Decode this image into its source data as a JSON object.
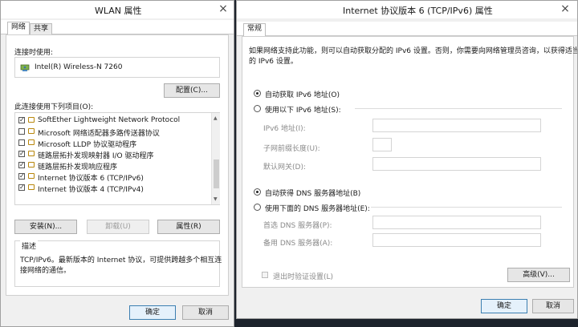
{
  "wlan": {
    "title": "WLAN 属性",
    "tabs": [
      "网络",
      "共享"
    ],
    "connect_label": "连接时使用:",
    "adapter_name": "Intel(R) Wireless-N 7260",
    "configure_label": "配置(C)...",
    "items_label": "此连接使用下列项目(O):",
    "items": [
      {
        "label": "SoftEther Lightweight Network Protocol",
        "checked": true
      },
      {
        "label": "Microsoft 网络适配器多路传送器协议",
        "checked": false
      },
      {
        "label": "Microsoft LLDP 协议驱动程序",
        "checked": false
      },
      {
        "label": "链路层拓扑发现映射器 I/O 驱动程序",
        "checked": true
      },
      {
        "label": "链路层拓扑发现响应程序",
        "checked": true
      },
      {
        "label": "Internet 协议版本 6 (TCP/IPv6)",
        "checked": true
      },
      {
        "label": "Internet 协议版本 4 (TCP/IPv4)",
        "checked": true
      }
    ],
    "install_label": "安装(N)...",
    "uninstall_label": "卸载(U)",
    "properties_label": "属性(R)",
    "desc_title": "描述",
    "desc_line1": "TCP/IPv6。最新版本的 Internet 协议，可提供跨越多个相互连",
    "desc_line2": "接网络的通信。",
    "ok_label": "确定",
    "cancel_label": "取消",
    "close_glyph": "×"
  },
  "ipv6": {
    "title": "Internet 协议版本 6 (TCP/IPv6) 属性",
    "tab": "常规",
    "intro_line1": "如果网络支持此功能，则可以自动获取分配的 IPv6 设置。否则，你需要向网络管理员咨询，以获得适当",
    "intro_line2": "的 IPv6 设置。",
    "auto_ip_label": "自动获取 IPv6 地址(O)",
    "manual_ip_label": "使用以下 IPv6 地址(S):",
    "ipv6_address_label": "IPv6 地址(I):",
    "prefix_label": "子网前缀长度(U):",
    "gateway_label": "默认网关(D):",
    "auto_dns_label": "自动获得 DNS 服务器地址(B)",
    "manual_dns_label": "使用下面的 DNS 服务器地址(E):",
    "preferred_dns_label": "首选 DNS 服务器(P):",
    "alternate_dns_label": "备用 DNS 服务器(A):",
    "validate_label": "退出时验证设置(L)",
    "advanced_label": "高级(V)...",
    "ok_label": "确定",
    "cancel_label": "取消",
    "close_glyph": "×"
  }
}
